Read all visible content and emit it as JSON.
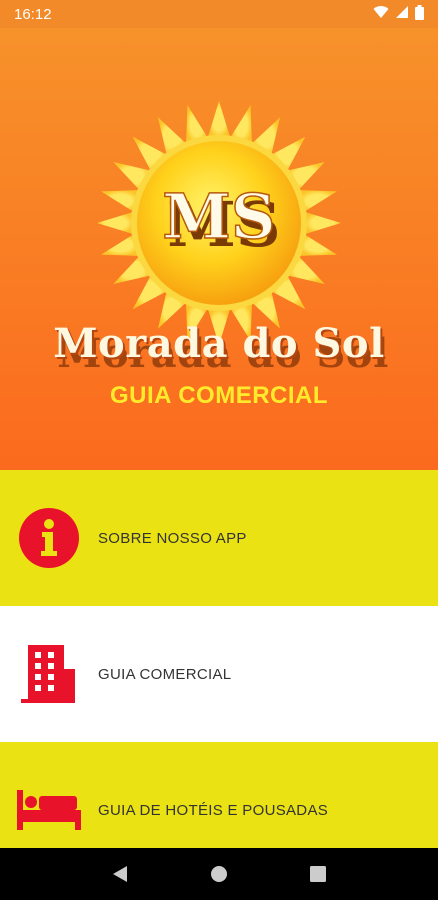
{
  "status_bar": {
    "time": "16:12",
    "icons": [
      "wifi-icon",
      "signal-icon",
      "battery-icon"
    ]
  },
  "header": {
    "logo_initials": "MS",
    "brand_name": "Morada do Sol",
    "subtitle": "GUIA COMERCIAL"
  },
  "menu": {
    "items": [
      {
        "label": "SOBRE NOSSO APP",
        "icon": "info-icon"
      },
      {
        "label": "GUIA COMERCIAL",
        "icon": "building-icon"
      },
      {
        "label": "GUIA DE HOTÉIS E POUSADAS",
        "icon": "bed-icon"
      }
    ]
  },
  "nav_bar": {
    "buttons": [
      "back-icon",
      "home-icon",
      "recents-icon"
    ]
  },
  "colors": {
    "header_top": "#f7922a",
    "header_bottom": "#fb6a1e",
    "yellow": "#eae213",
    "icon_red": "#e8132a"
  }
}
